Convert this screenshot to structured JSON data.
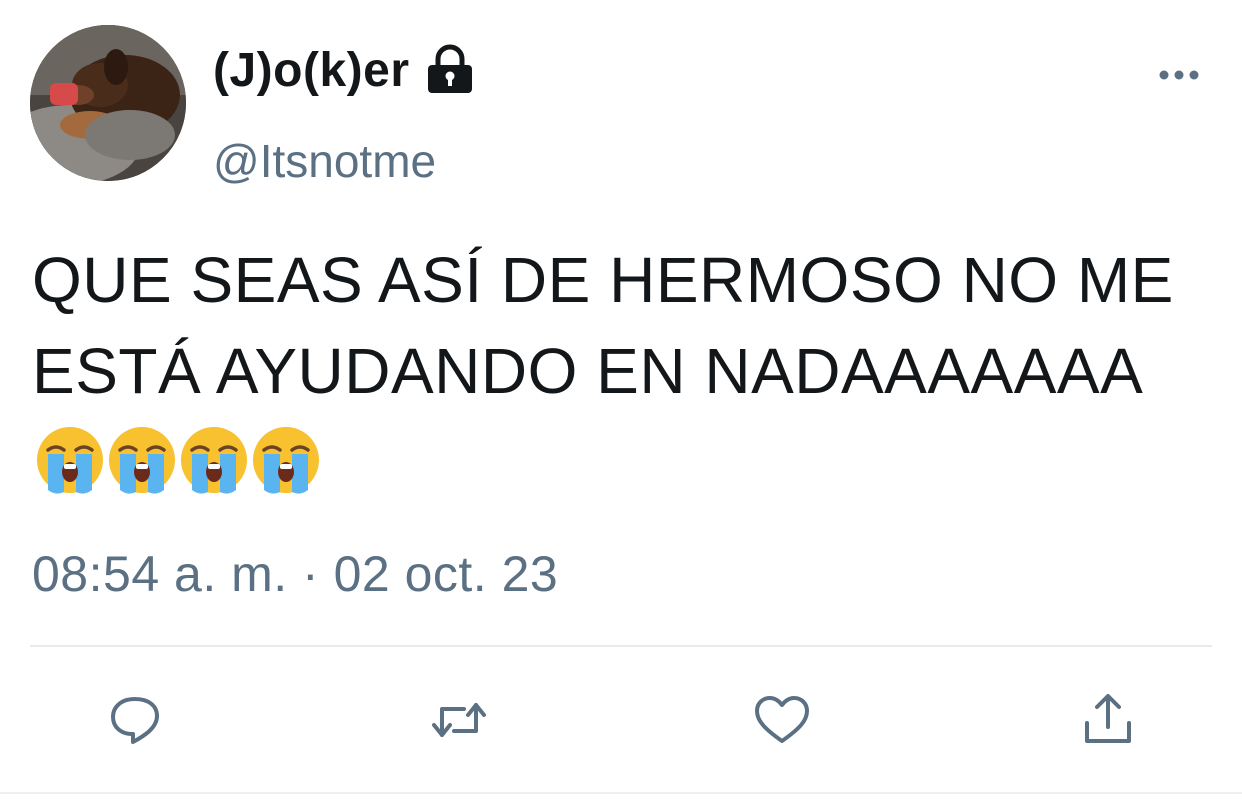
{
  "user": {
    "display_name": "(J)o(k)er",
    "handle": "@Itsnotme",
    "protected_icon": "lock-icon",
    "avatar": "puppy-photo"
  },
  "tweet": {
    "text": "QUE SEAS ASÍ DE HERMOSO NO ME ESTÁ AYUDANDO EN NADAAAAAAA",
    "emojis": [
      "loudly-crying-face",
      "loudly-crying-face",
      "loudly-crying-face",
      "loudly-crying-face"
    ],
    "timestamp": "08:54 a. m. · 02 oct. 23"
  },
  "actions": {
    "reply_icon": "reply-icon",
    "retweet_icon": "retweet-icon",
    "like_icon": "heart-icon",
    "share_icon": "share-icon"
  },
  "colors": {
    "text_primary": "#14171a",
    "text_secondary": "#5b7083",
    "divider": "#e6ecf0",
    "icon": "#5b7083"
  }
}
